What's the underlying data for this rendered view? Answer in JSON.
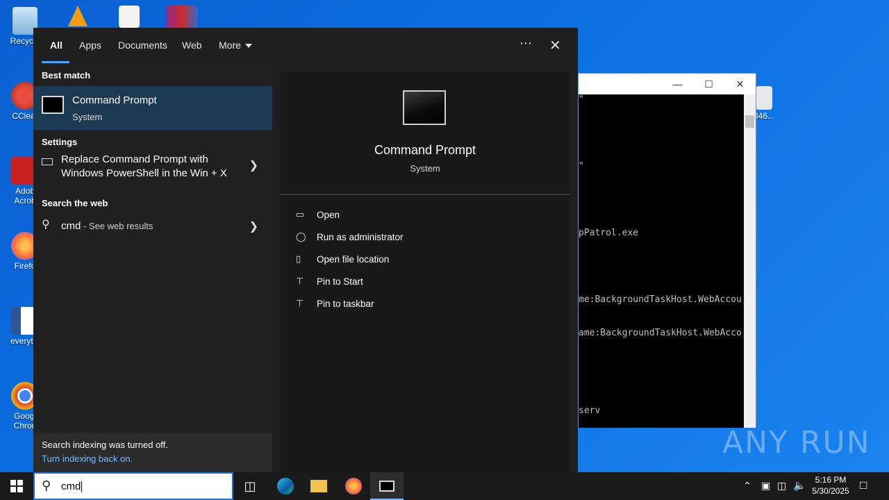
{
  "desktop": {
    "icons": [
      {
        "label": "Recycle",
        "name": "recycle-bin"
      },
      {
        "label": "CClear",
        "name": "ccleaner"
      },
      {
        "label": "Adob",
        "label2": "Acrob",
        "name": "adobe-acrobat"
      },
      {
        "label": "Firefo",
        "name": "firefox"
      },
      {
        "label": "everythi",
        "name": "word-document"
      },
      {
        "label": "Googl",
        "label2": "Chron",
        "name": "google-chrome"
      },
      {
        "label": "346...",
        "name": "file-346"
      }
    ]
  },
  "console": {
    "lines": [
      "\"",
      "\"",
      "pPatrol.exe",
      "me:BackgroundTaskHost.WebAccou",
      "ame:BackgroundTaskHost.WebAcco",
      "serv"
    ]
  },
  "search": {
    "tabs": [
      "All",
      "Apps",
      "Documents",
      "Web",
      "More"
    ],
    "active_tab": "All",
    "more_icon": "ellipsis-icon",
    "close_icon": "close-icon",
    "sections": {
      "best_match": "Best match",
      "settings": "Settings",
      "web": "Search the web"
    },
    "best_match": {
      "title": "Command Prompt",
      "subtitle": "System"
    },
    "settings_item": {
      "line1": "Replace Command Prompt with",
      "line2": "Windows PowerShell in the Win + X"
    },
    "web_item": {
      "query": "cmd",
      "suffix": " - See web results"
    },
    "indexing": {
      "message": "Search indexing was turned off.",
      "link": "Turn indexing back on."
    },
    "preview": {
      "title": "Command Prompt",
      "subtitle": "System",
      "actions": [
        {
          "label": "Open",
          "icon": "open-icon"
        },
        {
          "label": "Run as administrator",
          "icon": "shield-icon"
        },
        {
          "label": "Open file location",
          "icon": "file-location-icon"
        },
        {
          "label": "Pin to Start",
          "icon": "pin-icon"
        },
        {
          "label": "Pin to taskbar",
          "icon": "pin-icon"
        }
      ]
    }
  },
  "taskbar": {
    "search_query": "cmd",
    "clock_time": "5:16 PM",
    "clock_date": "5/30/2025"
  },
  "watermark": "ANY RUN"
}
